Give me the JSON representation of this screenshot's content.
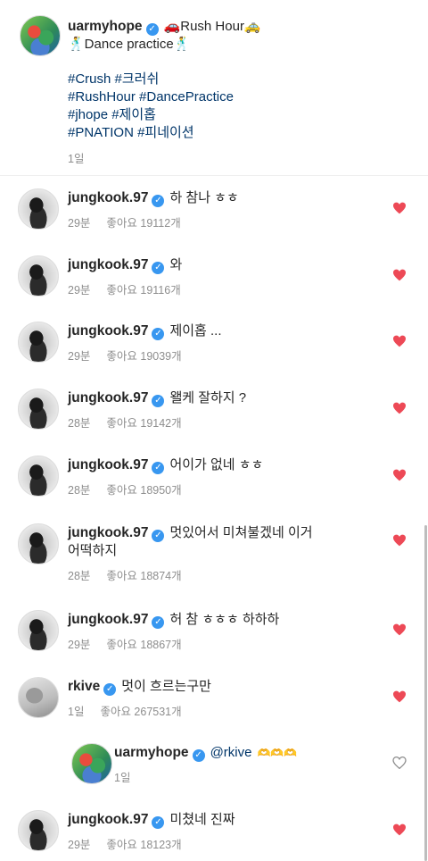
{
  "post": {
    "username": "uarmyhope",
    "title_line": "🚗Rush Hour🚕",
    "subtitle_line": "🕺Dance practice🕺",
    "hashtags": [
      "#Crush #크러쉬",
      "#RushHour #DancePractice",
      "#jhope #제이홉",
      "#PNATION #피네이션"
    ],
    "time": "1일"
  },
  "comments": [
    {
      "username": "jungkook.97",
      "text": "하 참나 ㅎㅎ",
      "time": "29분",
      "likes": "좋아요 19112개",
      "liked": true,
      "avatar": "jk"
    },
    {
      "username": "jungkook.97",
      "text": "와",
      "time": "29분",
      "likes": "좋아요 19116개",
      "liked": true,
      "avatar": "jk"
    },
    {
      "username": "jungkook.97",
      "text": "제이홉 ...",
      "time": "29분",
      "likes": "좋아요 19039개",
      "liked": true,
      "avatar": "jk"
    },
    {
      "username": "jungkook.97",
      "text": "왤케 잘하지 ?",
      "time": "28분",
      "likes": "좋아요 19142개",
      "liked": true,
      "avatar": "jk"
    },
    {
      "username": "jungkook.97",
      "text": "어이가 없네 ㅎㅎ",
      "time": "28분",
      "likes": "좋아요 18950개",
      "liked": true,
      "avatar": "jk"
    },
    {
      "username": "jungkook.97",
      "text": "멋있어서 미쳐불겠네 이거",
      "text2": "어떡하지",
      "time": "28분",
      "likes": "좋아요 18874개",
      "liked": true,
      "avatar": "jk"
    },
    {
      "username": "jungkook.97",
      "text": "허 참 ㅎㅎㅎ 하하하",
      "time": "29분",
      "likes": "좋아요 18867개",
      "liked": true,
      "avatar": "jk"
    },
    {
      "username": "rkive",
      "text": "멋이 흐르는구만",
      "time": "1일",
      "likes": "좋아요 267531개",
      "liked": true,
      "avatar": "rk"
    },
    {
      "username": "uarmyhope",
      "mention": "@rkive",
      "hearts": "🫶🫶🫶",
      "time": "1일",
      "liked": false,
      "avatar": "hope",
      "reply": true
    },
    {
      "username": "jungkook.97",
      "text": "미쳤네 진짜",
      "time": "29분",
      "likes": "좋아요 18123개",
      "liked": true,
      "avatar": "jk"
    }
  ],
  "colors": {
    "like_red": "#ed4956",
    "link_blue": "#003569",
    "verified_blue": "#3897f0",
    "meta_gray": "#8e8e8e"
  },
  "icons": {
    "verified": "verified-badge-icon",
    "heart_filled": "heart-filled-icon",
    "heart_outline": "heart-outline-icon"
  }
}
